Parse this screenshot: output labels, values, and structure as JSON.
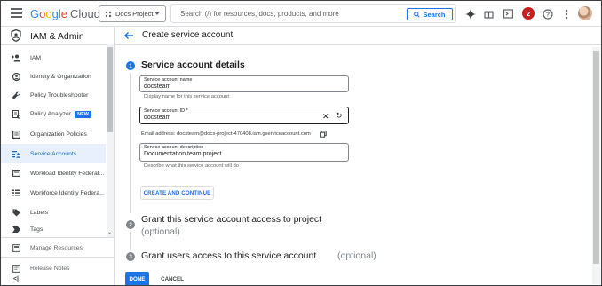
{
  "topbar": {
    "logo_google": [
      "G",
      "o",
      "o",
      "g",
      "l",
      "e"
    ],
    "logo_cloud": "Cloud",
    "project_label": "Docs Project",
    "search_placeholder": "Search (/) for resources, docs, products, and more",
    "search_button": "Search",
    "notification_count": "2"
  },
  "sidebar": {
    "title": "IAM & Admin",
    "items": [
      {
        "label": "IAM",
        "icon": "person-add-icon"
      },
      {
        "label": "Identity & Organization",
        "icon": "account-icon"
      },
      {
        "label": "Policy Troubleshooter",
        "icon": "wrench-icon"
      },
      {
        "label": "Policy Analyzer",
        "icon": "policy-analyzer-icon",
        "badge": "NEW"
      },
      {
        "label": "Organization Policies",
        "icon": "document-icon"
      },
      {
        "label": "Service Accounts",
        "icon": "service-account-icon",
        "active": true
      },
      {
        "label": "Workload Identity Federat...",
        "icon": "card-icon"
      },
      {
        "label": "Workforce Identity Federa...",
        "icon": "list-icon"
      },
      {
        "label": "Labels",
        "icon": "tag-icon"
      },
      {
        "label": "Tags",
        "icon": "chevron-tag-icon"
      }
    ],
    "manage_resources": "Manage Resources",
    "release_notes": "Release Notes",
    "collapse": "<|"
  },
  "main": {
    "page_title": "Create service account",
    "step1": {
      "number": "1",
      "title": "Service account details",
      "name_label": "Service account name",
      "name_value": "docsteam",
      "name_hint": "Display name for this service account",
      "id_label": "Service account ID *",
      "id_value": "docsteam",
      "email_text": "Email address: docsteam@docs-project-470408.iam.gserviceaccount.com",
      "desc_label": "Service account description",
      "desc_value": "Documentation team project",
      "desc_hint": "Describe what this service account will do",
      "create_button": "CREATE AND CONTINUE"
    },
    "step2": {
      "number": "2",
      "title": "Grant this service account access to project",
      "optional": "(optional)"
    },
    "step3": {
      "number": "3",
      "title": "Grant users access to this service account",
      "optional": "(optional)"
    },
    "done_button": "DONE",
    "cancel_button": "CANCEL"
  },
  "colors": {
    "accent": "#1a73e8",
    "active_bg": "#e8f0fe",
    "notification": "#c5221f"
  }
}
